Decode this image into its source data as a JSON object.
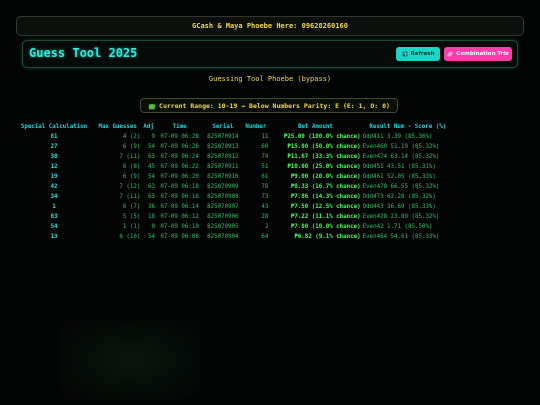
{
  "banner": {
    "text": "GCash & Maya Phoebe Here: 09628260160"
  },
  "header": {
    "title": "Guess Tool 2025",
    "refresh_label": "Refresh",
    "combo_label": "Combination Trix",
    "refresh_icon": "refresh-icon",
    "combo_icon": "link-icon"
  },
  "subtitle": "Guessing Tool Phoebe (bypass)",
  "range": {
    "icon": "puzzle-icon",
    "text": "Current Range: 10-19 → Below Numbers Parity: E (E: 1, O: 0)"
  },
  "table": {
    "headers": [
      "Special Calculation",
      "Max Guesses",
      "Adj",
      "Time",
      "Serial",
      "Number",
      "Bet Amount",
      "Result Num - Score (%)"
    ],
    "rows": [
      {
        "calc": "81",
        "guess": "4 (2)",
        "adj": "9",
        "time": "07-09 06:28",
        "serial": "825070914",
        "number": "11",
        "bet": "₱25.00 (100.0% chance)",
        "result": "Odd411  3.39 (85.36%)"
      },
      {
        "calc": "27",
        "guess": "6 (9)",
        "adj": "54",
        "time": "07-09 06:26",
        "serial": "825070913",
        "number": "60",
        "bet": "₱15.00 (50.0% chance)",
        "result": "Even460 51.19 (85.32%)"
      },
      {
        "calc": "38",
        "guess": "7 (11)",
        "adj": "63",
        "time": "07-09 06:24",
        "serial": "825070912",
        "number": "74",
        "bet": "₱11.67 (33.3% chance)",
        "result": "Even474 63.14 (85.32%)"
      },
      {
        "calc": "12",
        "guess": "6 (8)",
        "adj": "45",
        "time": "07-09 06:22",
        "serial": "825070911",
        "number": "51",
        "bet": "₱10.00 (25.0% chance)",
        "result": "Odd451  43.51 (85.31%)"
      },
      {
        "calc": "19",
        "guess": "6 (9)",
        "adj": "54",
        "time": "07-09 06:20",
        "serial": "825070910",
        "number": "61",
        "bet": "₱9.00 (20.0% chance)",
        "result": "Odd461  52.05 (85.33%)"
      },
      {
        "calc": "42",
        "guess": "7 (12)",
        "adj": "63",
        "time": "07-09 06:18",
        "serial": "825070909",
        "number": "78",
        "bet": "₱8.33 (16.7% chance)",
        "result": "Even478 66.55 (85.32%)"
      },
      {
        "calc": "34",
        "guess": "7 (11)",
        "adj": "63",
        "time": "07-09 06:16",
        "serial": "825070908",
        "number": "73",
        "bet": "₱7.86 (14.3% chance)",
        "result": "Odd473  62.28 (85.32%)"
      },
      {
        "calc": "1",
        "guess": "6 (7)",
        "adj": "36",
        "time": "07-09 06:14",
        "serial": "825070907",
        "number": "43",
        "bet": "₱7.50 (12.5% chance)",
        "result": "Odd443  36.69 (85.33%)"
      },
      {
        "calc": "83",
        "guess": "5 (5)",
        "adj": "18",
        "time": "07-09 06:12",
        "serial": "825070906",
        "number": "28",
        "bet": "₱7.22 (11.1% chance)",
        "result": "Even428 23.89 (85.32%)"
      },
      {
        "calc": "54",
        "guess": "1 (1)",
        "adj": "0",
        "time": "07-09 06:10",
        "serial": "825070905",
        "number": "2",
        "bet": "₱7.00 (10.0% chance)",
        "result": "Even42  1.71 (85.50%)"
      },
      {
        "calc": "13",
        "guess": "6 (10)",
        "adj": "54",
        "time": "07-09 06:08",
        "serial": "825070904",
        "number": "64",
        "bet": "₱6.82 (9.1% chance)",
        "result": "Even464 54.61 (85.33%)"
      }
    ]
  },
  "colors": {
    "background": "#030504",
    "accent_cyan": "#19d6e0",
    "accent_yellow": "#f2d84a",
    "bet_green": "#3cff5a",
    "refresh_button": "#19d6c6",
    "combo_button": "#ff3da8"
  }
}
